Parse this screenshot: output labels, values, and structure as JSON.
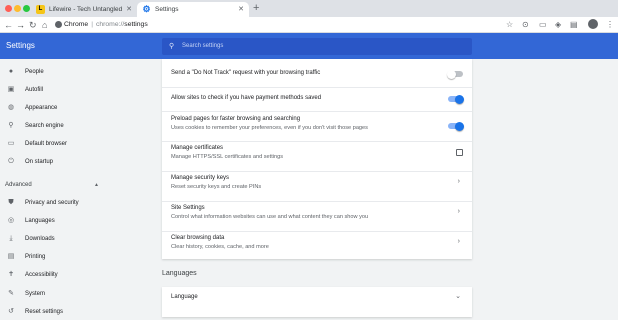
{
  "browser": {
    "tabs": [
      {
        "label": "Lifewire - Tech Untangled",
        "favicon": "L"
      },
      {
        "label": "Settings",
        "favicon": "gear"
      }
    ],
    "address": {
      "app": "Chrome",
      "separator": "|",
      "scheme": "chrome://",
      "path": "settings"
    }
  },
  "header": {
    "title": "Settings",
    "search_placeholder": "Search settings"
  },
  "sidebar": {
    "items": [
      {
        "label": "People",
        "icon": "person-icon"
      },
      {
        "label": "Autofill",
        "icon": "autofill-icon"
      },
      {
        "label": "Appearance",
        "icon": "palette-icon"
      },
      {
        "label": "Search engine",
        "icon": "search-icon"
      },
      {
        "label": "Default browser",
        "icon": "browser-icon"
      },
      {
        "label": "On startup",
        "icon": "power-icon"
      }
    ],
    "advanced_label": "Advanced",
    "advanced_items": [
      {
        "label": "Privacy and security",
        "icon": "shield-icon"
      },
      {
        "label": "Languages",
        "icon": "globe-icon"
      },
      {
        "label": "Downloads",
        "icon": "download-icon"
      },
      {
        "label": "Printing",
        "icon": "printer-icon"
      },
      {
        "label": "Accessibility",
        "icon": "accessibility-icon"
      },
      {
        "label": "System",
        "icon": "wrench-icon"
      },
      {
        "label": "Reset settings",
        "icon": "reset-icon"
      }
    ]
  },
  "privacy": {
    "rows": [
      {
        "label": "Send a \"Do Not Track\" request with your browsing traffic",
        "control": "toggle",
        "on": false
      },
      {
        "label": "Allow sites to check if you have payment methods saved",
        "control": "toggle",
        "on": true
      },
      {
        "label": "Preload pages for faster browsing and searching",
        "sub": "Uses cookies to remember your preferences, even if you don't visit those pages",
        "control": "toggle",
        "on": true
      },
      {
        "label": "Manage certificates",
        "sub": "Manage HTTPS/SSL certificates and settings",
        "control": "external"
      },
      {
        "label": "Manage security keys",
        "sub": "Reset security keys and create PINs",
        "control": "arrow"
      },
      {
        "label": "Site Settings",
        "sub": "Control what information websites can use and what content they can show you",
        "control": "arrow"
      },
      {
        "label": "Clear browsing data",
        "sub": "Clear history, cookies, cache, and more",
        "control": "arrow"
      }
    ]
  },
  "languages": {
    "section_title": "Languages",
    "row_label": "Language"
  },
  "colors": {
    "accent": "#3367d6",
    "toggle_on": "#1a73e8"
  }
}
